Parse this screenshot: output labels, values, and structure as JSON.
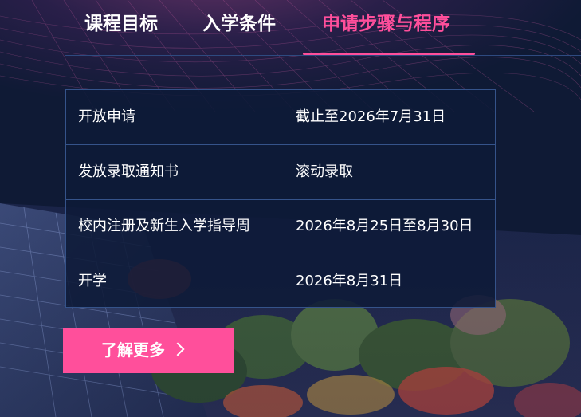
{
  "tabs": [
    {
      "label": "课程目标"
    },
    {
      "label": "入学条件"
    },
    {
      "label": "申请步骤与程序",
      "active": true
    }
  ],
  "schedule": {
    "rows": [
      {
        "label": "开放申请",
        "value": "截止至2026年7月31日"
      },
      {
        "label": "发放录取通知书",
        "value": "滚动录取"
      },
      {
        "label": "校内注册及新生入学指导周",
        "value": "2026年8月25日至8月30日"
      },
      {
        "label": "开学",
        "value": "2026年8月31日"
      }
    ]
  },
  "cta": {
    "label": "了解更多",
    "icon": "chevron-right-icon"
  },
  "colors": {
    "background": "#0f1a35",
    "accent": "#ff4f9b",
    "border": "#35538a",
    "text": "#ffffff"
  }
}
